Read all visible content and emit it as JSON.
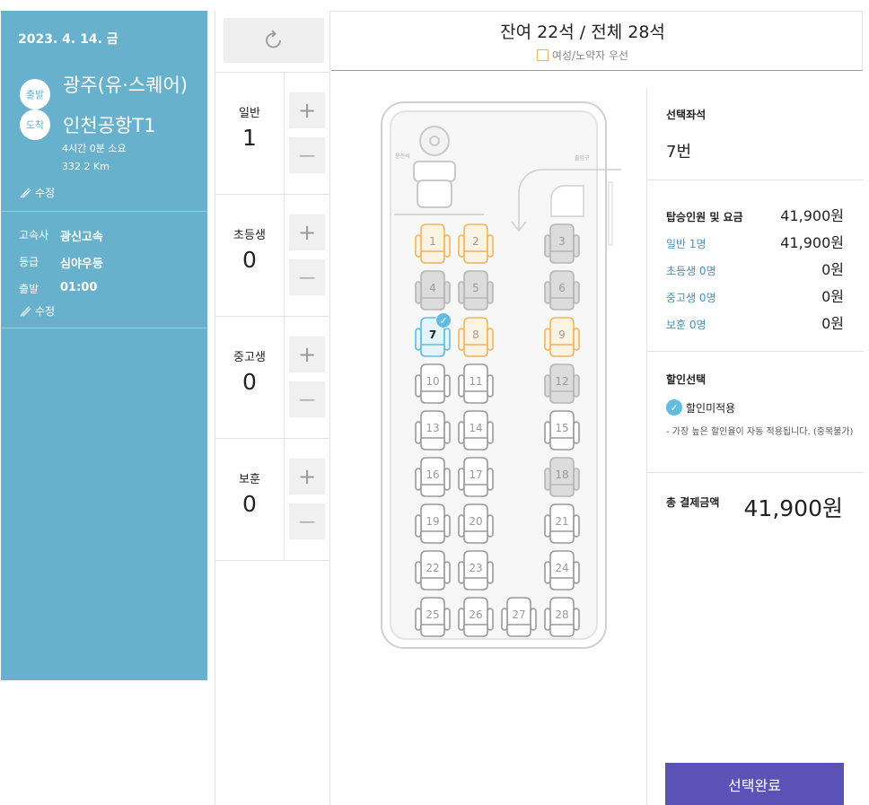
{
  "trip": {
    "date": "2023. 4. 14. 금",
    "depart_badge": "출발",
    "arrive_badge": "도착",
    "departure": "광주(유·스퀘어)",
    "arrival": "인천공항T1",
    "duration": "4시간 0분 소요",
    "distance": "332.2 Km",
    "edit_label": "수정",
    "company_key": "고속사",
    "company": "광신고속",
    "grade_key": "등급",
    "grade": "심야우등",
    "time_key": "출발",
    "time": "01:00",
    "edit_label2": "수정"
  },
  "passengers": [
    {
      "label": "일반",
      "count": "1"
    },
    {
      "label": "초등생",
      "count": "0"
    },
    {
      "label": "중고생",
      "count": "0"
    },
    {
      "label": "보훈",
      "count": "0"
    }
  ],
  "stepper": {
    "plus": "+",
    "minus": "—"
  },
  "seat_header": {
    "title": "잔여 22석 / 전체 28석",
    "legend": "여성/노약자 우선"
  },
  "bus_labels": {
    "driver": "운전석",
    "door": "출입구"
  },
  "seats": [
    {
      "n": "1",
      "state": "priority"
    },
    {
      "n": "2",
      "state": "priority"
    },
    {
      "n": "3",
      "state": "taken"
    },
    {
      "n": "4",
      "state": "taken"
    },
    {
      "n": "5",
      "state": "taken"
    },
    {
      "n": "6",
      "state": "taken"
    },
    {
      "n": "7",
      "state": "selected"
    },
    {
      "n": "8",
      "state": "priority"
    },
    {
      "n": "9",
      "state": "priority"
    },
    {
      "n": "10",
      "state": "available"
    },
    {
      "n": "11",
      "state": "available"
    },
    {
      "n": "12",
      "state": "taken"
    },
    {
      "n": "13",
      "state": "available"
    },
    {
      "n": "14",
      "state": "available"
    },
    {
      "n": "15",
      "state": "available"
    },
    {
      "n": "16",
      "state": "available"
    },
    {
      "n": "17",
      "state": "available"
    },
    {
      "n": "18",
      "state": "taken"
    },
    {
      "n": "19",
      "state": "available"
    },
    {
      "n": "20",
      "state": "available"
    },
    {
      "n": "21",
      "state": "available"
    },
    {
      "n": "22",
      "state": "available"
    },
    {
      "n": "23",
      "state": "available"
    },
    {
      "n": "24",
      "state": "available"
    },
    {
      "n": "25",
      "state": "available"
    },
    {
      "n": "26",
      "state": "available"
    },
    {
      "n": "27",
      "state": "available"
    },
    {
      "n": "28",
      "state": "available"
    }
  ],
  "colors": {
    "priority": "#f3b35d",
    "taken": "#c9c9c9",
    "available": "#9a9a9a",
    "selected": "#62bbe0",
    "button": "#5b52b8",
    "panel": "#67b1cd"
  },
  "summary": {
    "selected_heading": "선택좌석",
    "selected_value": "7번",
    "fare_heading": "탑승인원 및 요금",
    "fare_total": "41,900원",
    "rows": [
      {
        "label": "일반 1명",
        "value": "41,900원"
      },
      {
        "label": "초등생 0명",
        "value": "0원"
      },
      {
        "label": "중고생 0명",
        "value": "0원"
      },
      {
        "label": "보훈 0명",
        "value": "0원"
      }
    ],
    "discount_heading": "할인선택",
    "discount_option": "할인미적용",
    "discount_note": "- 가장 높은 할인율이 자동 적용됩니다. (중복불가)",
    "total_heading": "총 결제금액",
    "total_value": "41,900원"
  },
  "done_label": "선택완료"
}
